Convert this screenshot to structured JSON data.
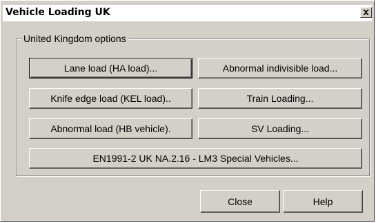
{
  "window": {
    "title": "Vehicle Loading UK",
    "close_glyph": "×"
  },
  "group": {
    "label": "United Kingdom options"
  },
  "buttons": {
    "lane_load": "Lane load (HA load)...",
    "abnormal_indivisible": "Abnormal indivisible load...",
    "knife_edge": "Knife edge load (KEL load)..",
    "train_loading": "Train Loading...",
    "abnormal_hb": "Abnormal load (HB vehicle).",
    "sv_loading": "SV Loading...",
    "en1991": "EN1991-2 UK NA.2.16 - LM3 Special Vehicles...",
    "close": "Close",
    "help": "Help"
  },
  "icons": {
    "close": "close-icon"
  },
  "colors": {
    "face": "#d4d0c8",
    "highlight": "#ffffff",
    "shadow": "#808080",
    "dark_shadow": "#404040"
  }
}
